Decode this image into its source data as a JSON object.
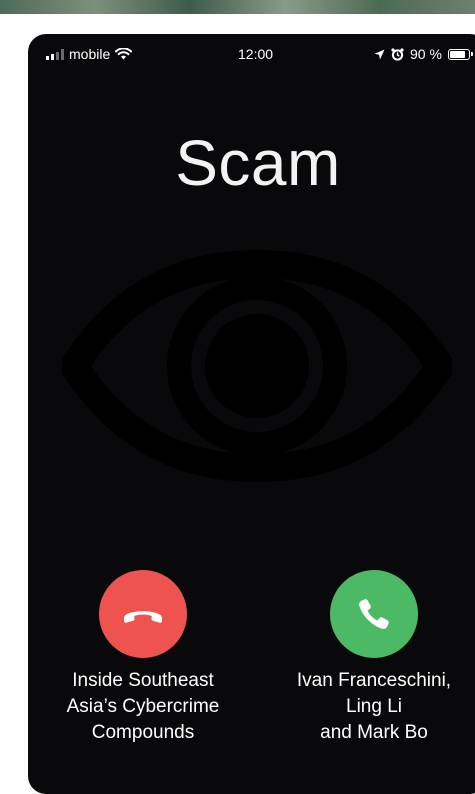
{
  "status_bar": {
    "carrier": "mobile",
    "time": "12:00",
    "battery": "90 %",
    "battery_level": 0.9
  },
  "title": "Scam",
  "icons": {
    "signal": "signal-bars-icon",
    "wifi": "wifi-icon",
    "location": "location-arrow-icon",
    "alarm": "alarm-clock-icon",
    "battery": "battery-icon",
    "eye": "eye-icon",
    "decline": "phone-hangup-icon",
    "accept": "phone-icon"
  },
  "colors": {
    "screen": "#09090b",
    "decline": "#ef5350",
    "accept": "#4cb964",
    "eye": "#000000"
  },
  "captions": {
    "left": [
      "Inside Southeast",
      "Asia’s Cybercrime",
      "Compounds"
    ],
    "right": [
      "Ivan Franceschini,",
      "Ling Li",
      "and Mark Bo"
    ]
  }
}
